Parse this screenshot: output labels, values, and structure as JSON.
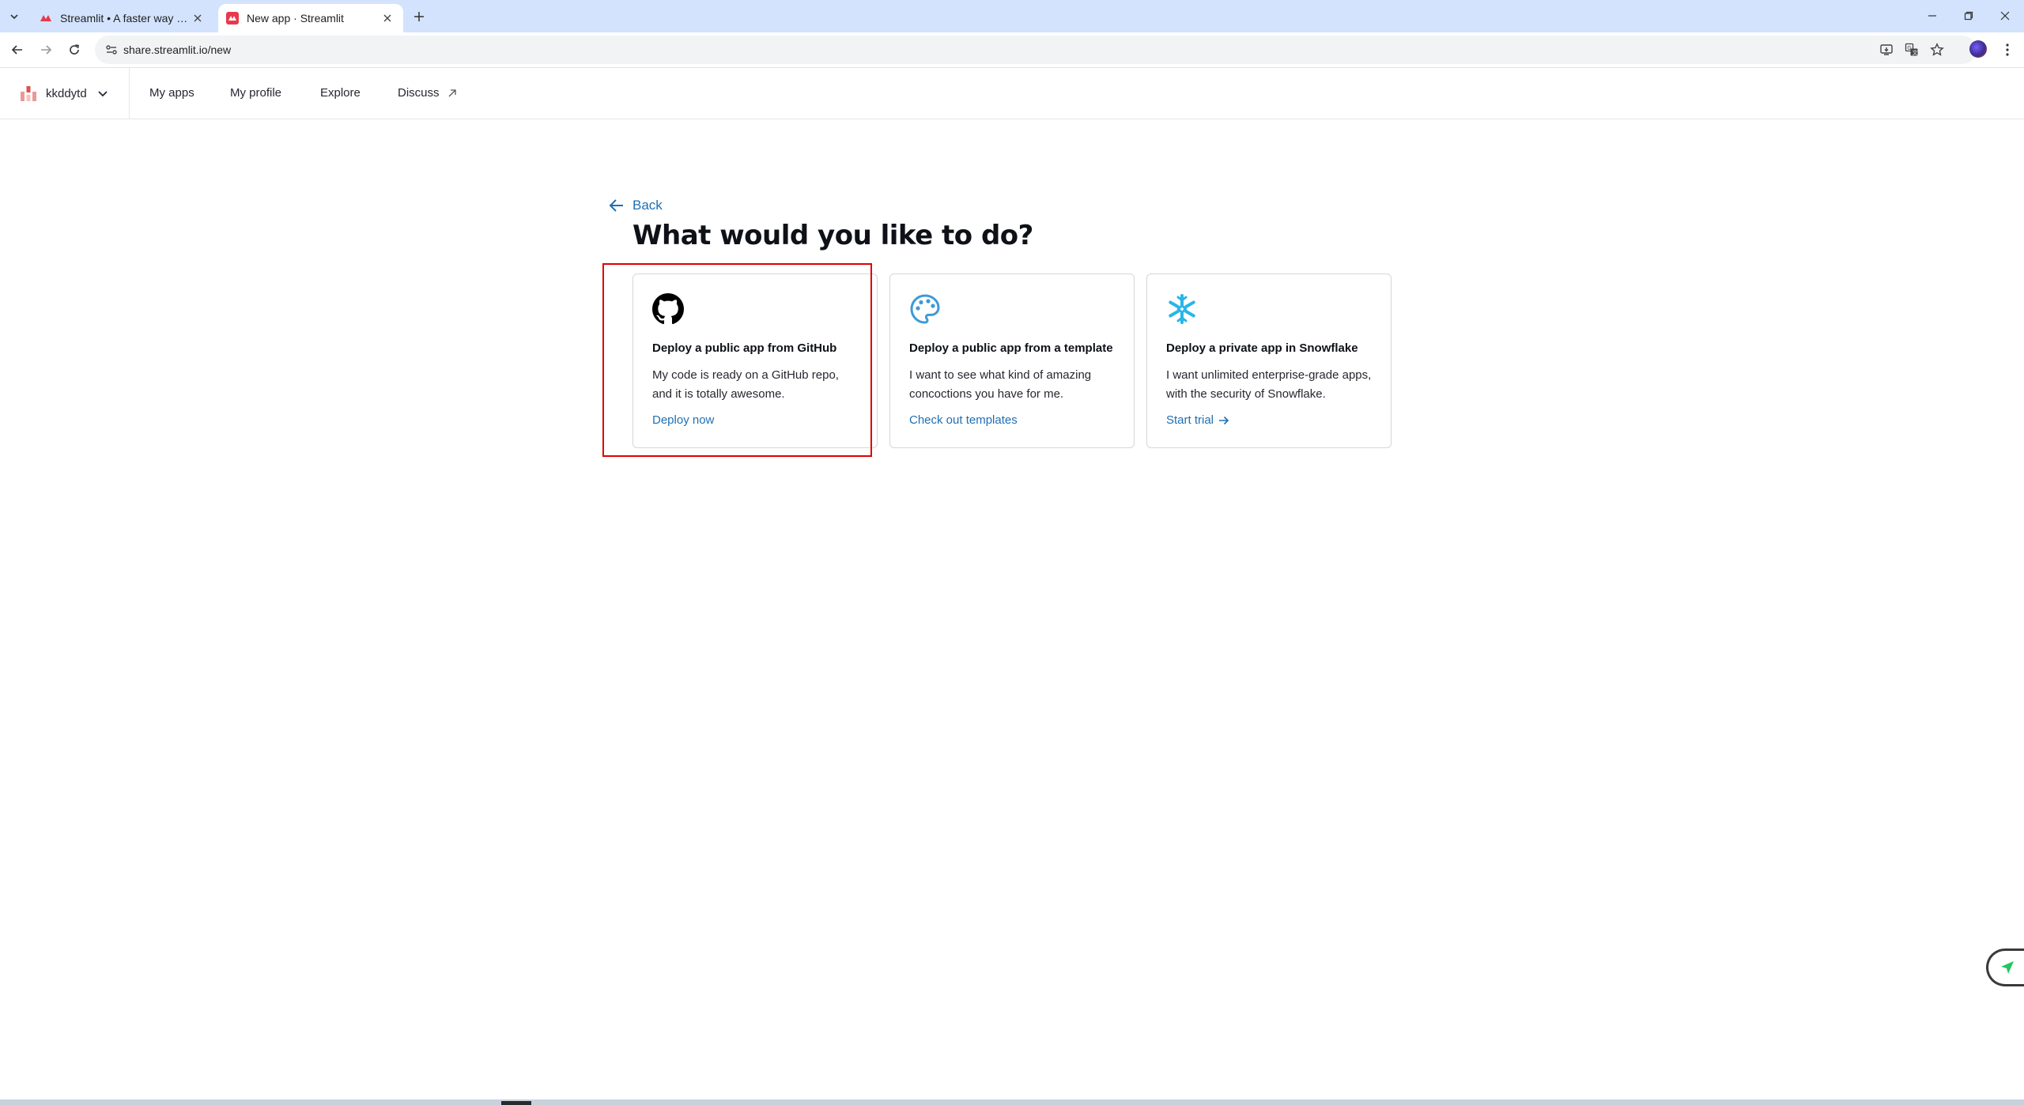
{
  "browser": {
    "tabs": [
      {
        "title": "Streamlit • A faster way to build",
        "active": false
      },
      {
        "title": "New app · Streamlit",
        "active": true
      }
    ],
    "url": "share.streamlit.io/new"
  },
  "header": {
    "workspace_name": "kkddytd",
    "nav": [
      "My apps",
      "My profile",
      "Explore",
      "Discuss"
    ]
  },
  "page": {
    "back_label": "Back",
    "title": "What would you like to do?",
    "cards": [
      {
        "icon": "github-icon",
        "title": "Deploy a public app from GitHub",
        "description": "My code is ready on a GitHub repo, and it is totally awesome.",
        "link": "Deploy now"
      },
      {
        "icon": "palette-icon",
        "title": "Deploy a public app from a template",
        "description": "I want to see what kind of amazing concoctions you have for me.",
        "link": "Check out templates"
      },
      {
        "icon": "snowflake-icon",
        "title": "Deploy a private app in Snowflake",
        "description": "I want unlimited enterprise-grade apps, with the security of Snowflake.",
        "link": "Start trial"
      }
    ]
  },
  "colors": {
    "accent_link": "#1f6fb2",
    "highlight": "#e00000",
    "tab_strip": "#d3e3fd"
  }
}
